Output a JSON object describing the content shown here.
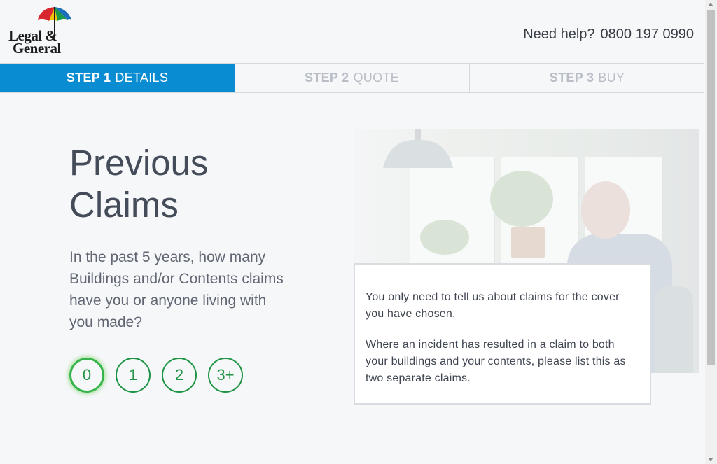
{
  "brand": {
    "logo_line1": "Legal &",
    "logo_line2": "General"
  },
  "help": {
    "label": "Need help?",
    "phone": "0800 197 0990"
  },
  "steps": [
    {
      "num": "STEP 1",
      "label": "DETAILS",
      "state": "active"
    },
    {
      "num": "STEP 2",
      "label": "QUOTE",
      "state": "inactive"
    },
    {
      "num": "STEP 3",
      "label": "BUY",
      "state": "inactive"
    }
  ],
  "page": {
    "title_line1": "Previous",
    "title_line2": "Claims",
    "question": "In the past 5 years, how many Buildings and/or Contents claims have you or anyone living with you made?",
    "options": [
      "0",
      "1",
      "2",
      "3+"
    ],
    "selected_option": "0"
  },
  "info": {
    "para1": "You only need to tell us about claims for the cover you have chosen.",
    "para2": "Where an incident has resulted in a claim to both your buildings and your contents, please list this as two separate claims."
  },
  "colors": {
    "active_step": "#0a8cd2",
    "option_green": "#1f9444",
    "selected_glow": "#37b44a",
    "title_text": "#454c59"
  },
  "icons": {
    "logo": "umbrella-icon"
  }
}
